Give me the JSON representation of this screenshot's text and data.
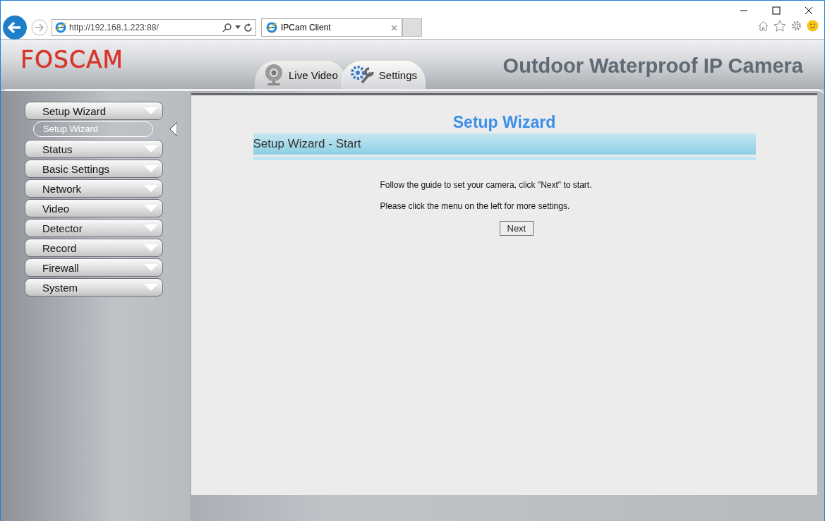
{
  "browser": {
    "url": "http://192.168.1.223:88/",
    "tab_title": "IPCam Client"
  },
  "header": {
    "logo": "FOSCAM",
    "tabs": [
      {
        "label": "Live Video",
        "kind": "camera",
        "selected": false
      },
      {
        "label": "Settings",
        "kind": "tools",
        "selected": true
      }
    ],
    "product": "Outdoor Waterproof IP Camera"
  },
  "menu": [
    {
      "label": "Setup Wizard",
      "children": [
        {
          "label": "Setup Wizard",
          "selected": true
        }
      ]
    },
    {
      "label": "Status"
    },
    {
      "label": "Basic Settings"
    },
    {
      "label": "Network"
    },
    {
      "label": "Video"
    },
    {
      "label": "Detector"
    },
    {
      "label": "Record"
    },
    {
      "label": "Firewall"
    },
    {
      "label": "System"
    }
  ],
  "content": {
    "title": "Setup Wizard",
    "section": "Setup Wizard - Start",
    "lines": [
      "Follow the guide to set your camera, click \"Next\" to start.",
      "Please click the menu on the left for more settings."
    ],
    "button": "Next"
  }
}
